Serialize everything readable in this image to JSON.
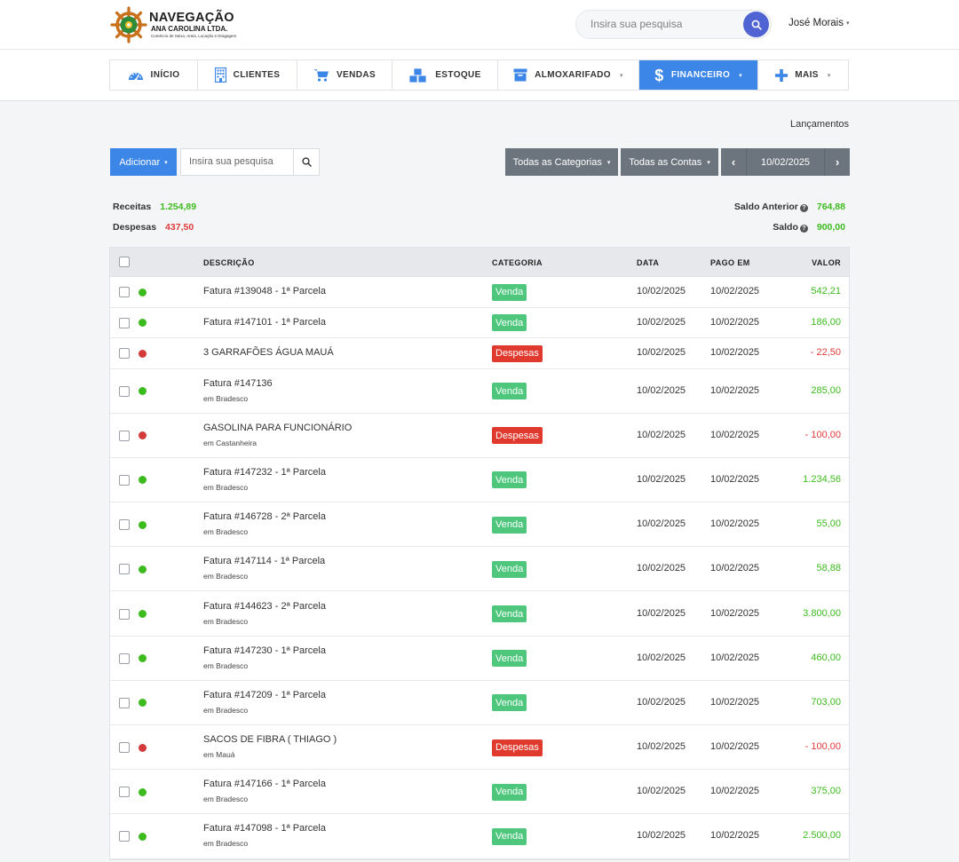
{
  "brand": {
    "title": "NAVEGAÇÃO",
    "subtitle": "ANA CAROLINA LTDA.",
    "tagline": "Comércio de Seixo, Areia, Locação e Dragagem"
  },
  "header": {
    "search_placeholder": "Insira sua pesquisa",
    "user_name": "José Morais"
  },
  "nav": {
    "items": [
      {
        "label": "INÍCIO",
        "icon": "dashboard-icon"
      },
      {
        "label": "CLIENTES",
        "icon": "building-icon"
      },
      {
        "label": "VENDAS",
        "icon": "cart-icon"
      },
      {
        "label": "ESTOQUE",
        "icon": "boxes-icon"
      },
      {
        "label": "ALMOXARIFADO",
        "icon": "archive-icon"
      },
      {
        "label": "FINANCEIRO",
        "icon": "dollar-icon"
      },
      {
        "label": "MAIS",
        "icon": "plus-icon"
      }
    ],
    "active": "FINANCEIRO"
  },
  "breadcrumb": "Lançamentos",
  "toolbar": {
    "add_label": "Adicionar",
    "search_placeholder": "Insira sua pesquisa",
    "categories_label": "Todas as Categorias",
    "accounts_label": "Todas as Contas",
    "date": "10/02/2025"
  },
  "summary": {
    "receitas_label": "Receitas",
    "receitas_value": "1.254,89",
    "despesas_label": "Despesas",
    "despesas_value": "437,50",
    "saldo_anterior_label": "Saldo Anterior",
    "saldo_anterior_value": "764,88",
    "saldo_label": "Saldo",
    "saldo_value": "900,00"
  },
  "table": {
    "columns": {
      "descricao": "DESCRIÇÃO",
      "categoria": "CATEGORIA",
      "data": "DATA",
      "pago_em": "PAGO EM",
      "valor": "VALOR"
    },
    "rows": [
      {
        "status": "ok",
        "desc": "Fatura #139048 - 1ª Parcela",
        "sub": "",
        "category": "Venda",
        "date": "10/02/2025",
        "paid": "10/02/2025",
        "value": "542,21"
      },
      {
        "status": "ok",
        "desc": "Fatura #147101 - 1ª Parcela",
        "sub": "",
        "category": "Venda",
        "date": "10/02/2025",
        "paid": "10/02/2025",
        "value": "186,00"
      },
      {
        "status": "bad",
        "desc": "3 GARRAFÕES ÁGUA MAUÁ",
        "sub": "",
        "category": "Despesas",
        "date": "10/02/2025",
        "paid": "10/02/2025",
        "value": "- 22,50"
      },
      {
        "status": "ok",
        "desc": "Fatura #147136",
        "sub": "em Bradesco",
        "category": "Venda",
        "date": "10/02/2025",
        "paid": "10/02/2025",
        "value": "285,00"
      },
      {
        "status": "bad",
        "desc": "GASOLINA PARA FUNCIONÁRIO",
        "sub": "em Castanheira",
        "category": "Despesas",
        "date": "10/02/2025",
        "paid": "10/02/2025",
        "value": "- 100,00"
      },
      {
        "status": "ok",
        "desc": "Fatura #147232 - 1ª Parcela",
        "sub": "em Bradesco",
        "category": "Venda",
        "date": "10/02/2025",
        "paid": "10/02/2025",
        "value": "1.234,56"
      },
      {
        "status": "ok",
        "desc": "Fatura #146728 - 2ª Parcela",
        "sub": "em Bradesco",
        "category": "Venda",
        "date": "10/02/2025",
        "paid": "10/02/2025",
        "value": "55,00"
      },
      {
        "status": "ok",
        "desc": "Fatura #147114 - 1ª Parcela",
        "sub": "em Bradesco",
        "category": "Venda",
        "date": "10/02/2025",
        "paid": "10/02/2025",
        "value": "58,88"
      },
      {
        "status": "ok",
        "desc": "Fatura #144623 - 2ª Parcela",
        "sub": "em Bradesco",
        "category": "Venda",
        "date": "10/02/2025",
        "paid": "10/02/2025",
        "value": "3.800,00"
      },
      {
        "status": "ok",
        "desc": "Fatura #147230 - 1ª Parcela",
        "sub": "em Bradesco",
        "category": "Venda",
        "date": "10/02/2025",
        "paid": "10/02/2025",
        "value": "460,00"
      },
      {
        "status": "ok",
        "desc": "Fatura #147209 - 1ª Parcela",
        "sub": "em Bradesco",
        "category": "Venda",
        "date": "10/02/2025",
        "paid": "10/02/2025",
        "value": "703,00"
      },
      {
        "status": "bad",
        "desc": "SACOS DE FIBRA ( THIAGO )",
        "sub": "em Mauá",
        "category": "Despesas",
        "date": "10/02/2025",
        "paid": "10/02/2025",
        "value": "- 100,00"
      },
      {
        "status": "ok",
        "desc": "Fatura #147166 - 1ª Parcela",
        "sub": "em Bradesco",
        "category": "Venda",
        "date": "10/02/2025",
        "paid": "10/02/2025",
        "value": "375,00"
      },
      {
        "status": "ok",
        "desc": "Fatura #147098 - 1ª Parcela",
        "sub": "em Bradesco",
        "category": "Venda",
        "date": "10/02/2025",
        "paid": "10/02/2025",
        "value": "2.500,00"
      }
    ]
  },
  "colors": {
    "primary": "#3c86e8",
    "positive": "#3dbb1e",
    "negative": "#e03b3b",
    "venda_badge": "#4ec77d",
    "despesa_badge": "#e03a2e",
    "filter_gray": "#6c757d"
  }
}
